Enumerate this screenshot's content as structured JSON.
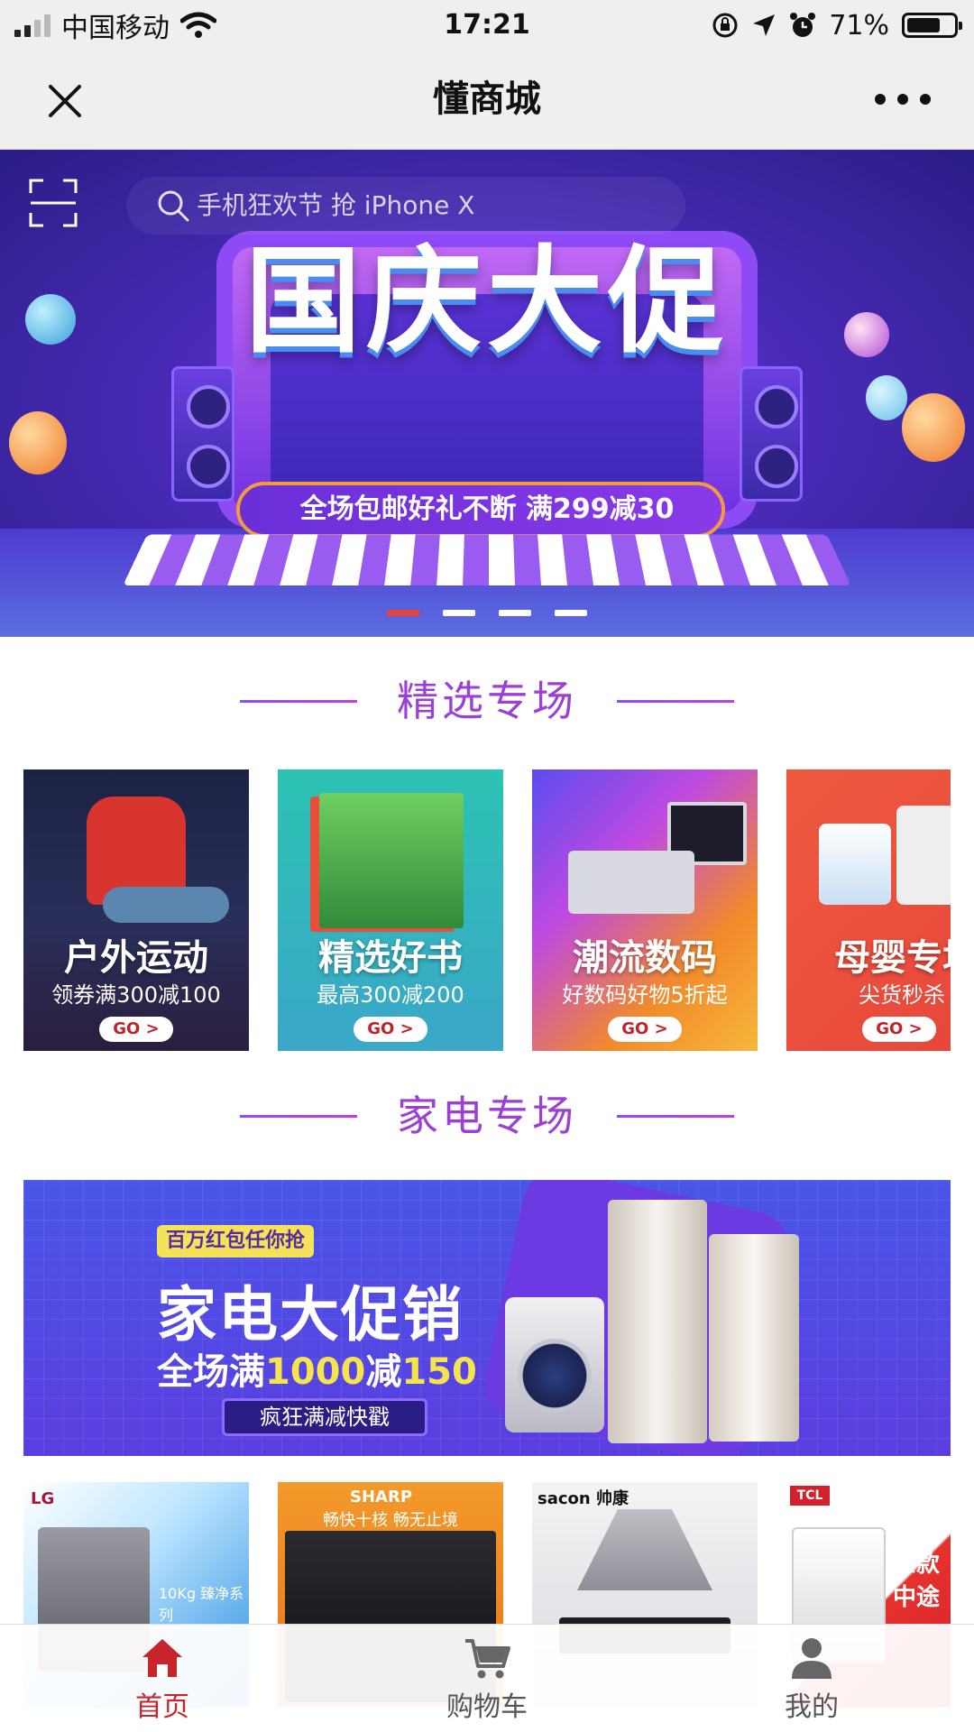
{
  "status_bar": {
    "carrier": "中国移动",
    "time": "17:21",
    "battery": "71%",
    "battery_level": 0.71
  },
  "nav": {
    "title": "懂商城"
  },
  "search": {
    "placeholder": "手机狂欢节 抢 iPhone X"
  },
  "hero_banner": {
    "title": "国庆大促",
    "subtitle": "全场包邮好礼不断 满299减30",
    "slide_count": 4,
    "active_slide": 1
  },
  "section_featured": {
    "title": "精选专场",
    "cards": [
      {
        "title": "户外运动",
        "subtitle": "领券满300减100",
        "button": "GO >"
      },
      {
        "title": "精选好书",
        "subtitle": "最高300减200",
        "button": "GO >"
      },
      {
        "title": "潮流数码",
        "subtitle": "好数码好物5折起",
        "button": "GO >"
      },
      {
        "title": "母婴专场",
        "subtitle": "尖货秒杀",
        "button": "GO >"
      }
    ]
  },
  "section_appliance": {
    "title": "家电专场",
    "banner": {
      "tag": "百万红包任你抢",
      "title": "家电大促销",
      "sub_prefix": "全场满",
      "sub_highlight": "1000",
      "sub_mid": "减",
      "sub_highlight2": "150",
      "pill": "疯狂满减快戳"
    },
    "tiles": [
      {
        "brand": "LG",
        "caption": "10Kg 臻净系列"
      },
      {
        "brand": "SHARP",
        "caption": "畅快十核 畅无止境"
      },
      {
        "brand": "sacon 帅康",
        "caption": ""
      },
      {
        "brand": "TCL",
        "caption": "爆款中途"
      }
    ]
  },
  "tab_bar": {
    "items": [
      {
        "label": "首页",
        "icon": "home-icon",
        "active": true
      },
      {
        "label": "购物车",
        "icon": "cart-icon",
        "active": false
      },
      {
        "label": "我的",
        "icon": "user-icon",
        "active": false
      }
    ]
  },
  "colors": {
    "accent_purple": "#9b3fd6",
    "active_red": "#c8242c"
  }
}
